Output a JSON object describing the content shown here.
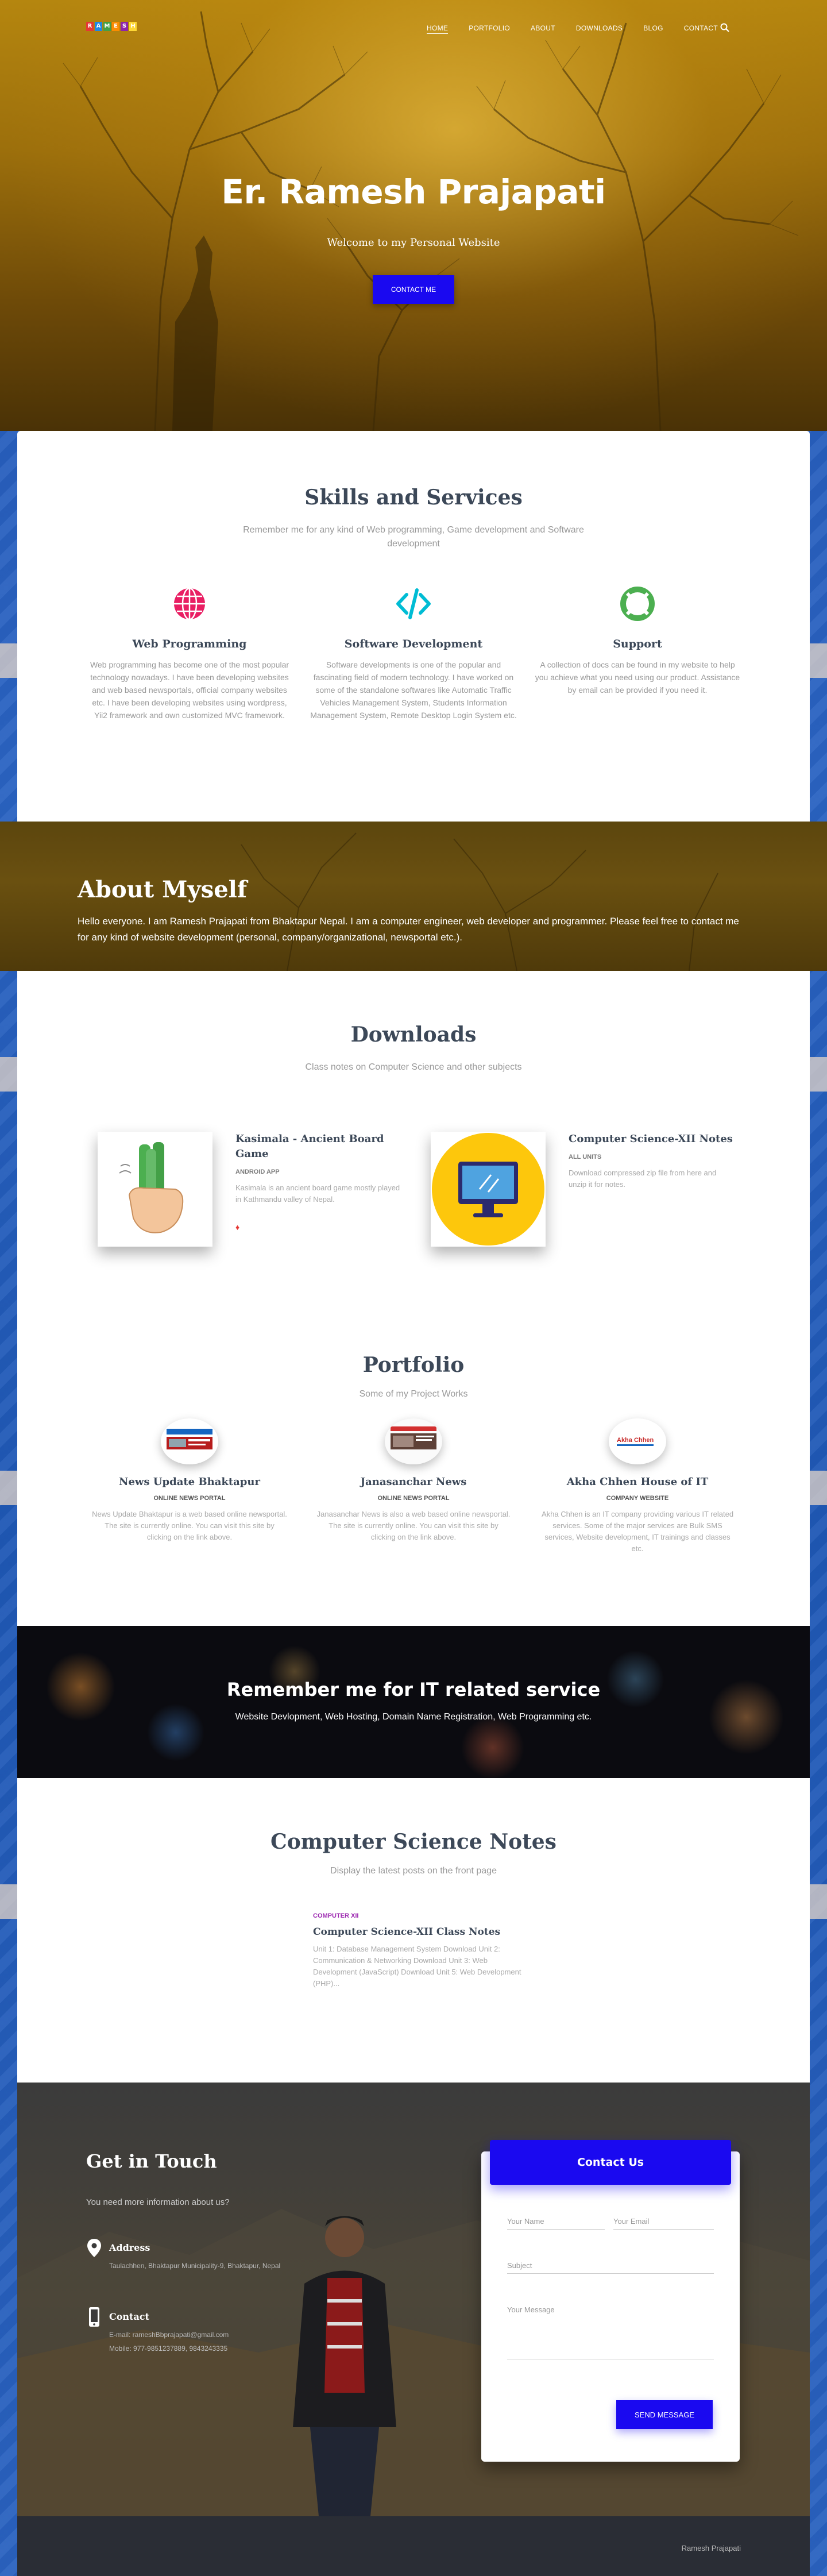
{
  "colors": {
    "brand": "#1a09f0",
    "accent_pink": "#e91e63",
    "accent_cyan": "#00bcd4",
    "accent_green": "#4caf50"
  },
  "nav": {
    "logo_letters": [
      "R",
      "A",
      "M",
      "E",
      "S",
      "H"
    ],
    "logo_colors": [
      "#e53935",
      "#1e88e5",
      "#43a047",
      "#fb8c00",
      "#8e24aa",
      "#fdd835"
    ],
    "items": [
      "Home",
      "Portfolio",
      "About",
      "Downloads",
      "Blog",
      "Contact"
    ],
    "search_icon": "search-icon"
  },
  "hero": {
    "title": "Er. Ramesh Prajapati",
    "subtitle": "Welcome to my Personal Website",
    "button": "Contact me"
  },
  "skills": {
    "title": "Skills and Services",
    "subtitle": "Remember me for any kind of Web programming, Game development and Software development",
    "items": [
      {
        "icon": "globe-icon",
        "title": "Web Programming",
        "text": "Web programming has become one of the most popular technology nowadays. I have been developing websites and web based newsportals, official company websites etc. I have been developing websites using wordpress, Yii2 framework and own customized MVC framework."
      },
      {
        "icon": "code-icon",
        "title": "Software Development",
        "text": "Software developments is one of the popular and fascinating field of modern technology. I have worked on some of the standalone softwares like Automatic Traffic Vehicles Management System, Students Information Management System, Remote Desktop Login System etc."
      },
      {
        "icon": "lifebuoy-icon",
        "title": "Support",
        "text": "A collection of docs can be found in my website to help you achieve what you need using our product. Assistance by email can be provided if you need it."
      }
    ]
  },
  "about": {
    "title": "About Myself",
    "text": "Hello everyone. I am Ramesh Prajapati from Bhaktapur Nepal. I am a computer engineer, web developer and programmer. Please feel free to contact me for any kind of website development (personal, company/organizational, newsportal etc.)."
  },
  "downloads": {
    "title": "Downloads",
    "subtitle": "Class notes on Computer Science and other subjects",
    "items": [
      {
        "name": "Kasimala - Ancient Board Game",
        "category": "Android App",
        "description": "Kasimala is an ancient board game mostly played in Kathmandu valley of Nepal.",
        "mark": "♦"
      },
      {
        "name": "Computer Science-XII Notes",
        "category": "All Units",
        "description": "Download compressed zip file from here and unzip it for notes."
      }
    ]
  },
  "portfolio": {
    "title": "Portfolio",
    "subtitle": "Some of my Project Works",
    "items": [
      {
        "title": "News Update Bhaktapur",
        "category": "Online News Portal",
        "description": "News Update Bhaktapur is a web based online newsportal. The site is currently online. You can visit this site by clicking on the link above."
      },
      {
        "title": "Janasanchar News",
        "category": "Online News Portal",
        "description": "Janasanchar News is also a web based online newsportal. The site is currently online. You can visit this site by clicking on the link above."
      },
      {
        "title": "Akha Chhen House of IT",
        "category": "Company Website",
        "description": "Akha Chhen is an IT company providing various IT related services. Some of the major services are Bulk SMS services, Website development, IT trainings and classes etc.",
        "logo_text": "Akha Chhen"
      }
    ]
  },
  "remember": {
    "title": "Remember me for IT related service",
    "text": "Website Devlopment, Web Hosting, Domain Name Registration, Web Programming etc."
  },
  "notes": {
    "title": "Computer Science Notes",
    "subtitle": "Display the latest posts on the front page",
    "post": {
      "category": "Computer XII",
      "title": "Computer Science-XII Class Notes",
      "excerpt": "Unit 1: Database Management System Download Unit 2: Communication & Networking Download Unit 3: Web Development (JavaScript) Download Unit 5: Web Development (PHP)..."
    }
  },
  "contact": {
    "title": "Get in Touch",
    "subtitle": "You need more information about us?",
    "address_label": "Address",
    "address_text": "Taulachhen, Bhaktapur Municipality-9, Bhaktapur, Nepal",
    "contact_label": "Contact",
    "email_line": "E-mail: rameshBbprajapati@gmail.com",
    "mobile_line": "Mobile: 977-9851237889, 9843243335",
    "form_title": "Contact Us",
    "name_placeholder": "Your Name",
    "email_placeholder": "Your Email",
    "subject_placeholder": "Subject",
    "message_placeholder": "Your Message",
    "send_button": "Send Message"
  },
  "footer": {
    "text": "Ramesh Prajapati"
  }
}
